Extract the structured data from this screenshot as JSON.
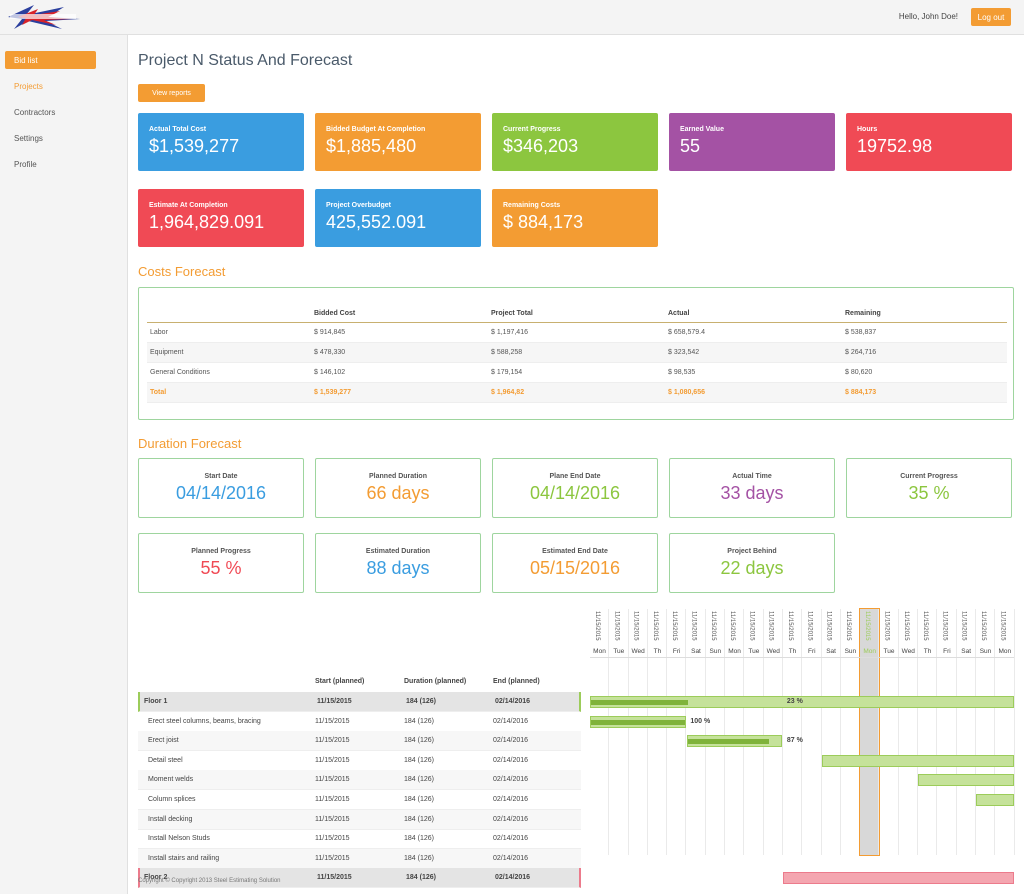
{
  "header": {
    "greeting": "Hello, John Doe!",
    "logout_label": "Log out"
  },
  "sidebar": {
    "items": [
      {
        "label": "Bid list"
      },
      {
        "label": "Projects"
      },
      {
        "label": "Contractors"
      },
      {
        "label": "Settings"
      },
      {
        "label": "Profile"
      }
    ]
  },
  "page": {
    "title": "Project N Status And Forecast",
    "view_reports_label": "View reports"
  },
  "kpis": [
    {
      "label": "Actual Total Cost",
      "value": "$1,539,277",
      "color": "#3a9de0"
    },
    {
      "label": "Bidded Budget At Completion",
      "value": "$1,885,480",
      "color": "#f39c33"
    },
    {
      "label": "Current Progress",
      "value": "$346,203",
      "color": "#8cc63f"
    },
    {
      "label": "Earned Value",
      "value": "55",
      "color": "#a452a4"
    },
    {
      "label": "Hours",
      "value": "19752.98",
      "color": "#f04a55"
    },
    {
      "label": "Estimate At Completion",
      "value": "1,964,829.091",
      "color": "#f04a55"
    },
    {
      "label": "Project Overbudget",
      "value": "425,552.091",
      "color": "#3a9de0"
    },
    {
      "label": "Remaining Costs",
      "value": "$ 884,173",
      "color": "#f39c33"
    }
  ],
  "costs": {
    "title": "Costs Forecast",
    "headers": [
      "",
      "Bidded Cost",
      "Project Total",
      "Actual",
      "Remaining"
    ],
    "rows": [
      [
        "Labor",
        "$ 914,845",
        "$ 1,197,416",
        "$ 658,579.4",
        "$ 538,837"
      ],
      [
        "Equipment",
        "$ 478,330",
        "$ 588,258",
        "$ 323,542",
        "$ 264,716"
      ],
      [
        "General Conditions",
        "$ 146,102",
        "$ 179,154",
        "$ 98,535",
        "$ 80,620"
      ],
      [
        "Total",
        "$ 1,539,277",
        "$ 1,964,82",
        "$ 1,080,656",
        "$ 884,173"
      ]
    ]
  },
  "duration": {
    "title": "Duration Forecast",
    "items": [
      {
        "label": "Start Date",
        "value": "04/14/2016",
        "color": "#3a9de0"
      },
      {
        "label": "Planned Duration",
        "value": "66 days",
        "color": "#f39c33"
      },
      {
        "label": "Plane End Date",
        "value": "04/14/2016",
        "color": "#8cc63f"
      },
      {
        "label": "Actual Time",
        "value": "33 days",
        "color": "#a452a4"
      },
      {
        "label": "Current Progress",
        "value": "35 %",
        "color": "#8cc63f"
      },
      {
        "label": "Planned Progress",
        "value": "55 %",
        "color": "#f04a55"
      },
      {
        "label": "Estimated Duration",
        "value": "88 days",
        "color": "#3a9de0"
      },
      {
        "label": "Estimated End Date",
        "value": "05/15/2016",
        "color": "#f39c33"
      },
      {
        "label": "Project Behind",
        "value": "22 days",
        "color": "#8cc63f"
      }
    ]
  },
  "gantt": {
    "headers": [
      "Start (planned)",
      "Duration (planned)",
      "End (planned)"
    ],
    "rows": [
      {
        "name": "Floor 1",
        "start": "11/15/2015",
        "dur": "184 (126)",
        "end": "02/14/2016",
        "group": true
      },
      {
        "name": "Erect steel columns, beams, bracing",
        "start": "11/15/2015",
        "dur": "184 (126)",
        "end": "02/14/2016"
      },
      {
        "name": "Erect joist",
        "start": "11/15/2015",
        "dur": "184 (126)",
        "end": "02/14/2016"
      },
      {
        "name": "Detail steel",
        "start": "11/15/2015",
        "dur": "184 (126)",
        "end": "02/14/2016"
      },
      {
        "name": "Moment welds",
        "start": "11/15/2015",
        "dur": "184 (126)",
        "end": "02/14/2016"
      },
      {
        "name": "Column splices",
        "start": "11/15/2015",
        "dur": "184 (126)",
        "end": "02/14/2016"
      },
      {
        "name": "Install decking",
        "start": "11/15/2015",
        "dur": "184 (126)",
        "end": "02/14/2016"
      },
      {
        "name": "Install Nelson Studs",
        "start": "11/15/2015",
        "dur": "184 (126)",
        "end": "02/14/2016"
      },
      {
        "name": "Install stairs and railing",
        "start": "11/15/2015",
        "dur": "184 (126)",
        "end": "02/14/2016"
      },
      {
        "name": "Floor 2",
        "start": "11/15/2015",
        "dur": "184 (126)",
        "end": "02/14/2016",
        "group": true
      }
    ],
    "date_label": "11/15/2015",
    "days": [
      "Mon",
      "Tue",
      "Wed",
      "Th",
      "Fri",
      "Sat",
      "Sun",
      "Mon",
      "Tue",
      "Wed",
      "Th",
      "Fri",
      "Sat",
      "Sun",
      "Mon",
      "Tue",
      "Wed",
      "Th",
      "Fri",
      "Sat",
      "Sun",
      "Mon"
    ],
    "today_index": 14,
    "bars": [
      {
        "row": 0,
        "start": 0,
        "end": 22,
        "progress": 0.23,
        "label": "23 %",
        "label_col": 10.2
      },
      {
        "row": 1,
        "start": 0,
        "end": 5,
        "progress": 1.0,
        "label": "100 %",
        "label_col": 5.2
      },
      {
        "row": 2,
        "start": 5,
        "end": 10,
        "progress": 0.87,
        "label": "87 %",
        "label_col": 10.2
      },
      {
        "row": 3,
        "start": 12,
        "end": 22,
        "progress": 0
      },
      {
        "row": 4,
        "start": 17,
        "end": 22,
        "progress": 0
      },
      {
        "row": 5,
        "start": 20,
        "end": 22,
        "progress": 0
      },
      {
        "row": 9,
        "start": 10,
        "end": 22,
        "progress": 0,
        "red": true
      }
    ]
  },
  "footer": "Copyright © Copyright 2013 Steel Estimating Solution"
}
